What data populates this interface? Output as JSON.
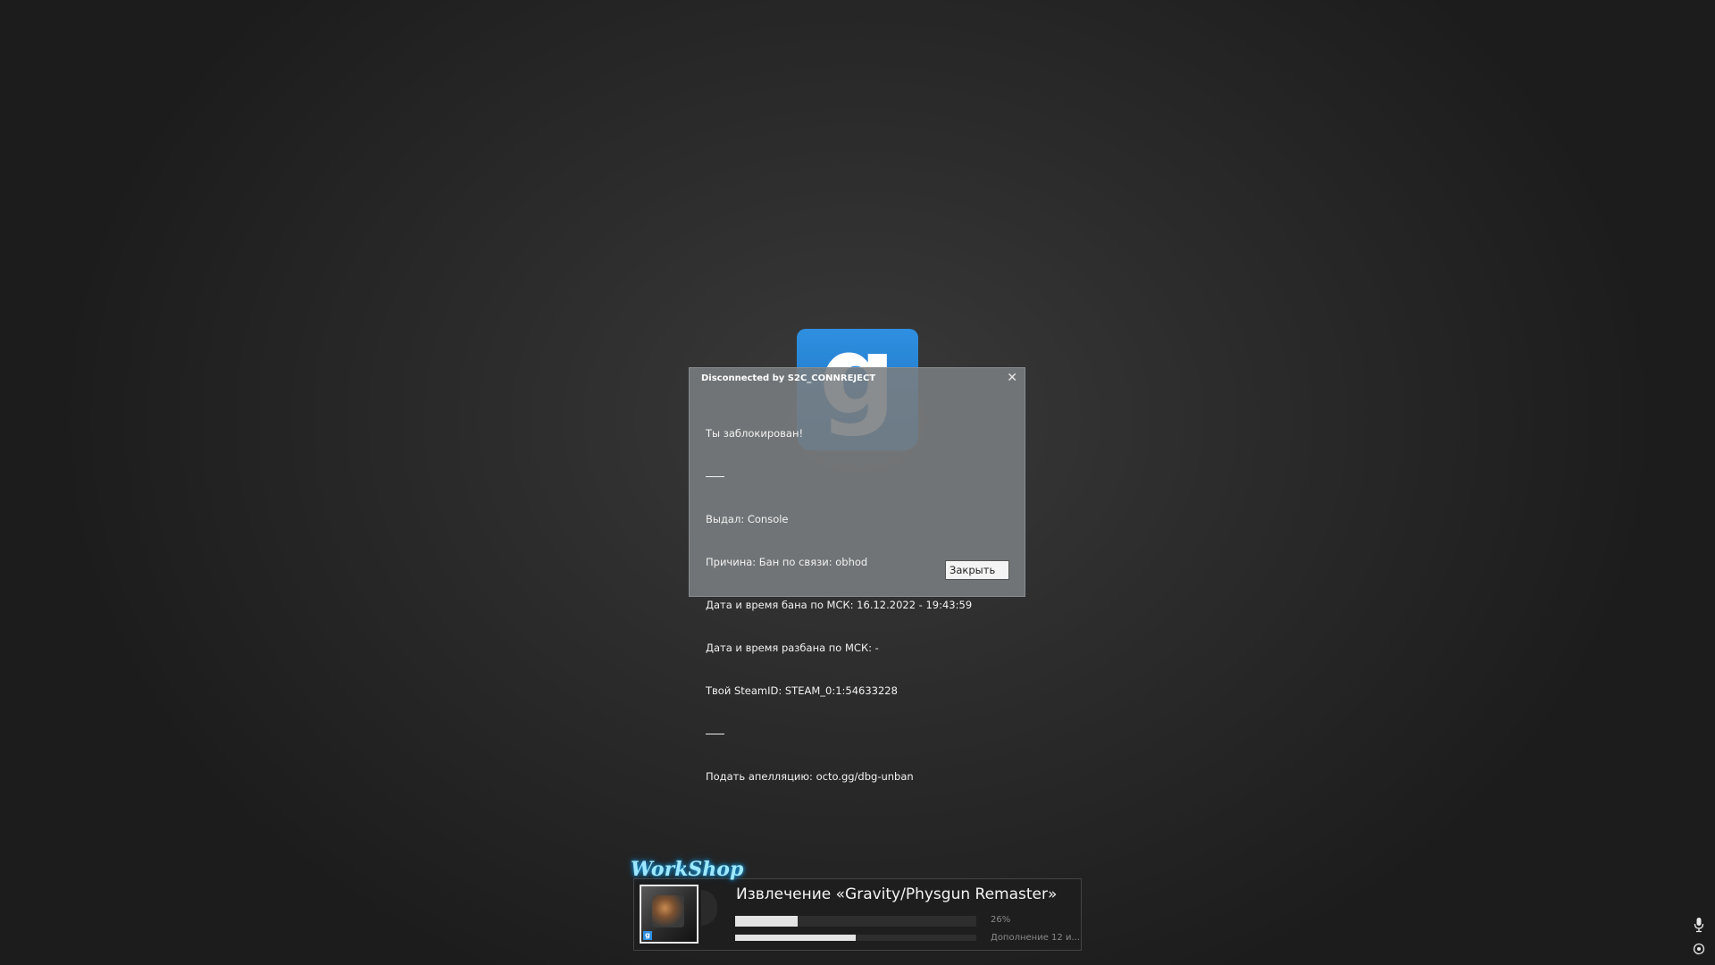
{
  "dialog": {
    "title": "Disconnected by S2C_CONNREJECT",
    "lines": [
      "Ты заблокирован!",
      "Выдал: Console",
      "Причина: Бан по связи: obhod",
      "Дата и время бана по МСК: 16.12.2022 - 19:43:59",
      "Дата и время разбана по МСК: -",
      "Твой SteamID: STEAM_0:1:54633228",
      "Подать апелляцию: octo.gg/dbg-unban"
    ],
    "close_button": "Закрыть",
    "close_icon": "close-icon"
  },
  "logo": {
    "letter": "g"
  },
  "workshop": {
    "logo_text": "WorkShop",
    "title": "Извлечение «Gravity/Physgun Remaster»",
    "progress_percent_label": "26%",
    "progress_fraction": 0.26,
    "overall_fraction": 0.5,
    "subtitle": "Дополнение 12 и..."
  },
  "colors": {
    "accent": "#2f8fe0",
    "dialog_bg": "#7a7d80"
  },
  "icons": {
    "mic": "microphone-icon",
    "target": "target-icon"
  }
}
